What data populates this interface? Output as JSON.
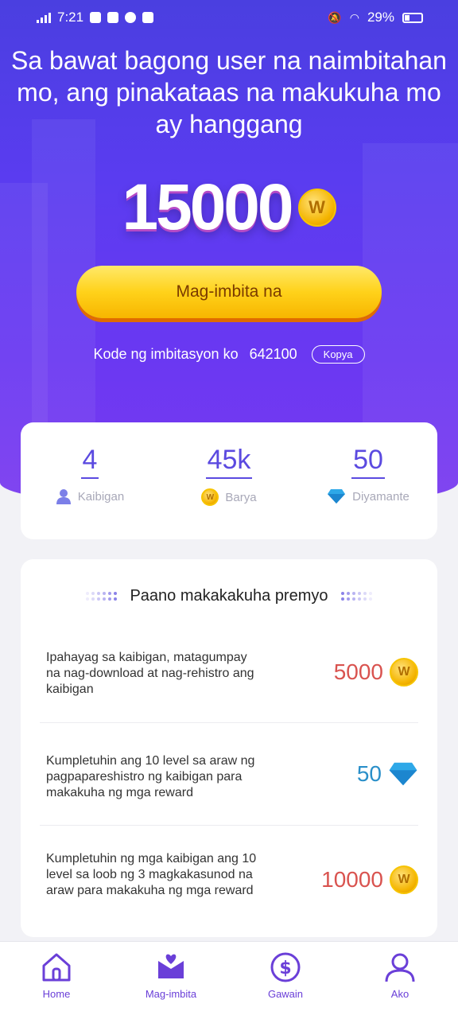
{
  "status_bar": {
    "time": "7:21",
    "battery": "29%"
  },
  "headline": "Sa bawat bagong user na naimbitahan mo, ang pinakataas na makukuha mo ay hanggang",
  "max_reward": "15000",
  "invite_button": "Mag-imbita na",
  "invite_code": {
    "label": "Kode ng imbitasyon ko",
    "code": "642100",
    "copy_label": "Kopya"
  },
  "stats": [
    {
      "value": "4",
      "label": "Kaibigan",
      "icon": "person-icon"
    },
    {
      "value": "45k",
      "label": "Barya",
      "icon": "coin-icon"
    },
    {
      "value": "50",
      "label": "Diyamante",
      "icon": "diamond-icon"
    }
  ],
  "how_to": {
    "title": "Paano makakakuha premyo",
    "items": [
      {
        "text": "Ipahayag sa kaibigan, matagumpay na nag-download at nag-rehistro ang kaibigan",
        "reward": "5000",
        "reward_icon": "coin-icon",
        "color": "#d9534f"
      },
      {
        "text": "Kumpletuhin ang 10 level sa araw ng pagpapareshistro ng kaibigan para makakuha ng mga reward",
        "reward": "50",
        "reward_icon": "diamond-icon",
        "color": "#2a8fc9"
      },
      {
        "text": "Kumpletuhin ng mga kaibigan ang 10 level sa loob ng 3 magkakasunod na araw para makakuha ng mga reward",
        "reward": "10000",
        "reward_icon": "coin-icon",
        "color": "#d9534f"
      }
    ]
  },
  "nav": [
    {
      "label": "Home",
      "icon": "home-icon"
    },
    {
      "label": "Mag-imbita",
      "icon": "invite-icon"
    },
    {
      "label": "Gawain",
      "icon": "dollar-icon"
    },
    {
      "label": "Ako",
      "icon": "profile-icon"
    }
  ],
  "colors": {
    "accent": "#5b4ae0",
    "hero": "#5a3cf0",
    "button": "#ffd21a"
  }
}
